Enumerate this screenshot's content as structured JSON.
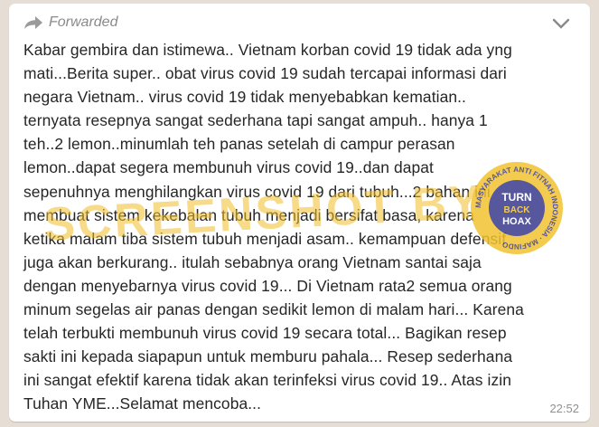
{
  "message": {
    "forwarded_label": "Forwarded",
    "lines": [
      "Kabar gembira dan istimewa.. Vietnam korban covid 19 tidak ada yng",
      "mati...Berita super.. obat virus covid 19  sudah tercapai informasi dari",
      "negara Vietnam.. virus covid 19 tidak menyebabkan kematian..",
      "ternyata resepnya sangat sederhana tapi sangat ampuh.. hanya 1",
      "teh..2 lemon..minumlah teh panas setelah di campur perasan",
      "lemon..dapat segera membunuh virus covid 19..dan dapat",
      "sepenuhnya menghilangkan virus covid 19 dari tubuh...2 bahan ini",
      "membuat sistem kekebalan tubuh menjadi bersifat basa, karena",
      "ketika malam tiba sistem tubuh menjadi asam.. kemampuan defensif",
      "juga akan berkurang.. itulah sebabnya orang Vietnam santai saja",
      "dengan menyebarnya virus covid 19... Di Vietnam rata2 semua orang",
      "minum segelas air panas dengan sedikit lemon di malam hari... Karena",
      "telah terbukti membunuh virus covid 19 secara total... Bagikan resep",
      "sakti ini kepada siapapun untuk memburu pahala... Resep sederhana",
      "ini sangat efektif karena tidak akan terinfeksi virus covid 19.. Atas izin",
      "Tuhan YME...Selamat mencoba..."
    ],
    "time": "22:52"
  },
  "watermark": {
    "text": "SCREENSHOT BY",
    "seal_lines": [
      "TURN",
      "BACK",
      "HOAX"
    ],
    "seal_ring_text": "MASYARAKAT ANTI FITNAH INDONESIA · MAFINDO"
  },
  "colors": {
    "background": "#e6ddd4",
    "bubble": "#ffffff",
    "text": "#262626",
    "meta": "#8a8a8a",
    "seal_blue": "#3a3a8c",
    "seal_yellow": "#f2c230"
  },
  "icons": {
    "forward": "forward-arrow-icon",
    "menu": "chevron-down-icon"
  }
}
